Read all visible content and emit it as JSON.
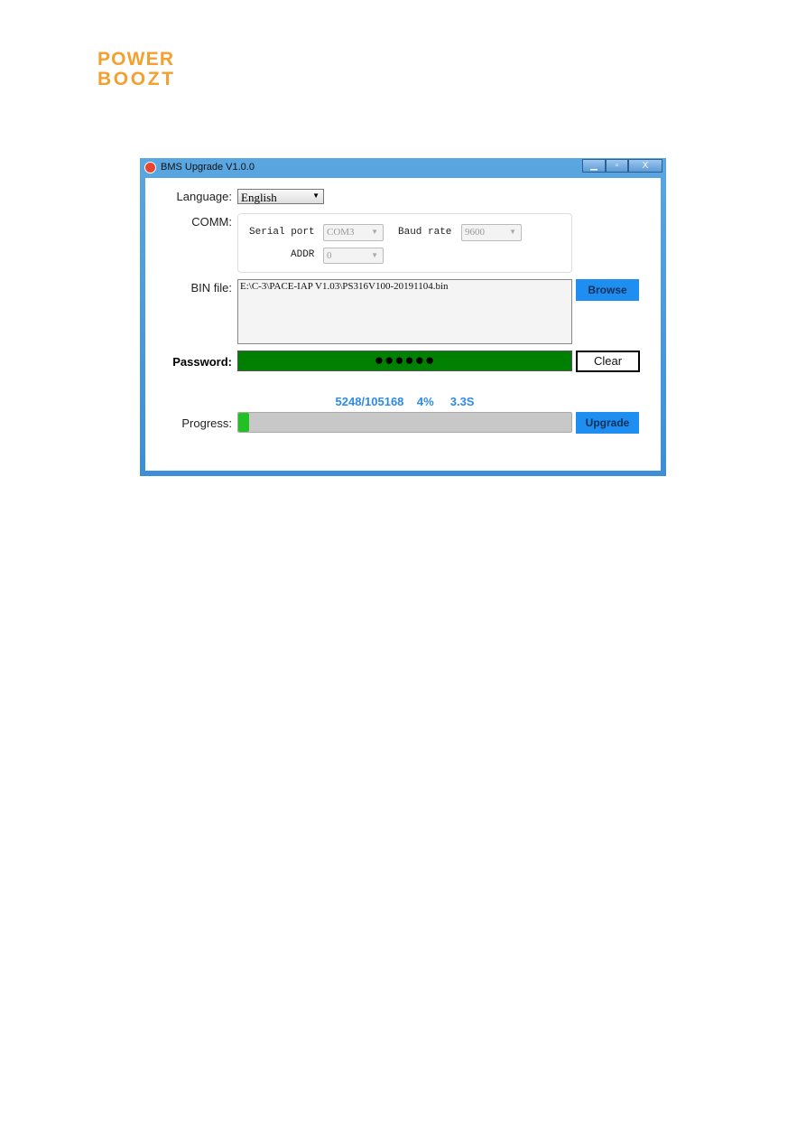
{
  "document": {
    "logo_text": "POWER BOOZT"
  },
  "window": {
    "title": "BMS Upgrade V1.0.0",
    "controls": [
      "minimize",
      "maximize",
      "close"
    ],
    "close_glyph": "X"
  },
  "language": {
    "label": "Language:",
    "value": "English"
  },
  "comm": {
    "label": "COMM:",
    "serial_port_label": "Serial port",
    "serial_port_value": "COM3",
    "baud_rate_label": "Baud rate",
    "baud_rate_value": "9600",
    "addr_label": "ADDR",
    "addr_value": "0"
  },
  "bin_file": {
    "label": "BIN file:",
    "value": "E:\\C-3\\PACE-IAP V1.03\\PS316V100-20191104.bin",
    "browse_label": "Browse"
  },
  "password": {
    "label": "Password:",
    "value": "●●●●●●",
    "clear_label": "Clear",
    "field_color": "#008000"
  },
  "progress": {
    "label": "Progress:",
    "count": "5248/105168",
    "percent_text": "4%",
    "time": "3.3S",
    "percent": 4,
    "upgrade_label": "Upgrade",
    "text_color": "#2e8ae6",
    "fill_color": "#22c022"
  }
}
